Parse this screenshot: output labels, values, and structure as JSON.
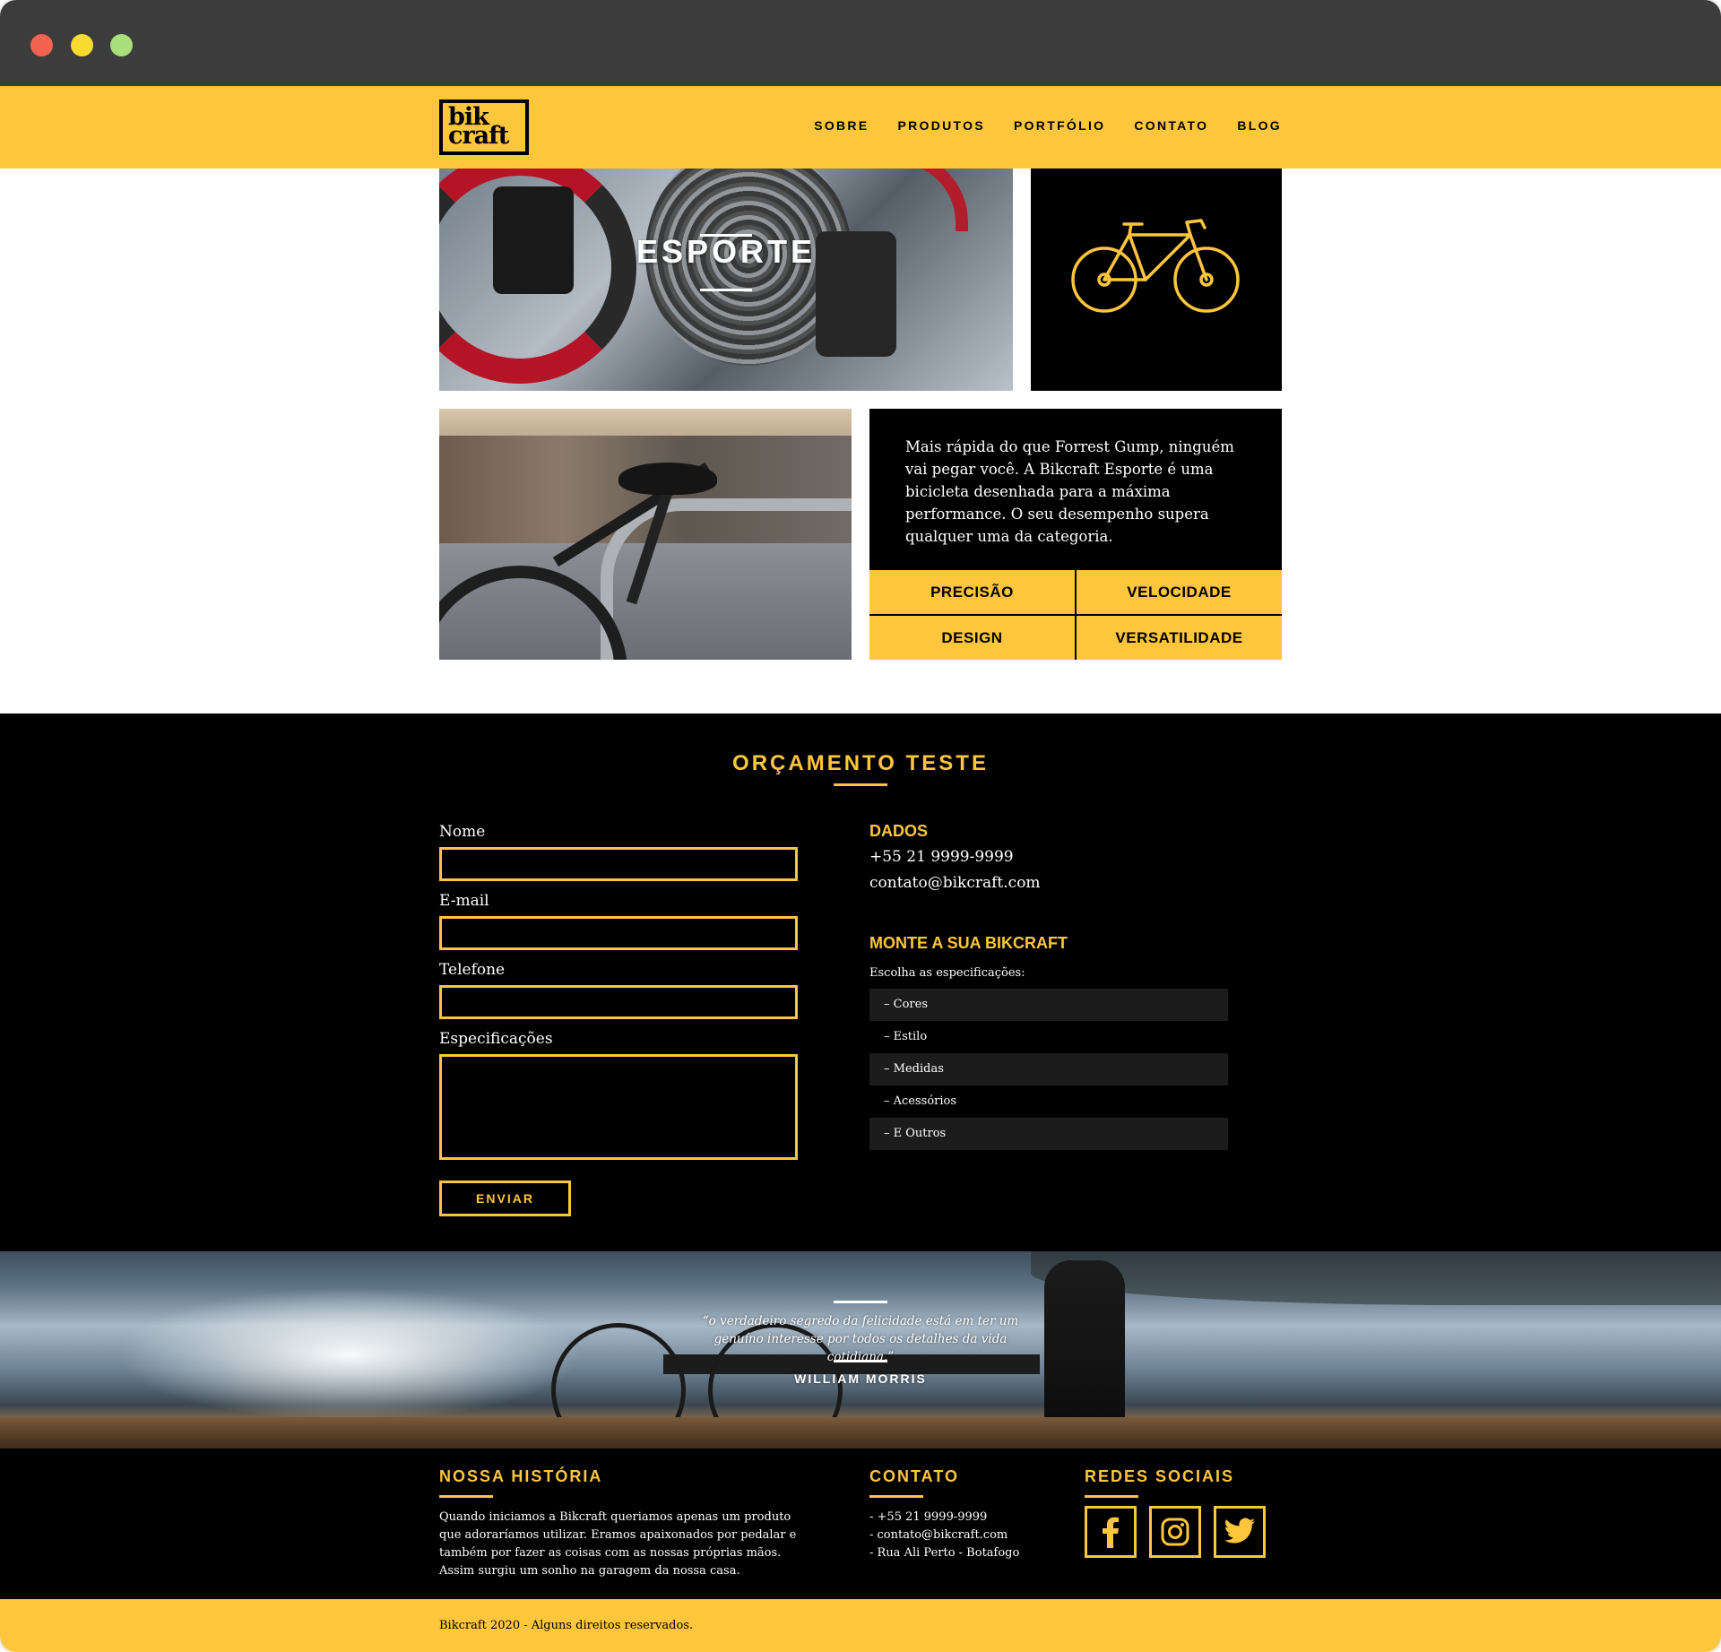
{
  "header": {
    "logo_line1": "bik",
    "logo_line2": "craft",
    "nav": [
      "SOBRE",
      "PRODUTOS",
      "PORTFÓLIO",
      "CONTATO",
      "BLOG"
    ]
  },
  "hero": {
    "title": "ESPORTE"
  },
  "product": {
    "description": "Mais rápida do que Forrest Gump, ninguém vai pegar você. A Bikcraft Esporte é uma bicicleta desenhada para a máxima performance. O seu desempenho supera qualquer uma da categoria.",
    "features": [
      "PRECISÃO",
      "VELOCIDADE",
      "DESIGN",
      "VERSATILIDADE"
    ]
  },
  "form": {
    "title": "ORÇAMENTO TESTE",
    "name_label": "Nome",
    "email_label": "E-mail",
    "phone_label": "Telefone",
    "specs_label": "Especificações",
    "submit_label": "ENVIAR"
  },
  "info": {
    "dados_title": "DADOS",
    "phone": "+55 21 9999-9999",
    "email": "contato@bikcraft.com",
    "build_title": "MONTE A SUA BIKCRAFT",
    "build_intro": "Escolha as especificações:",
    "specs": [
      "– Cores",
      "– Estilo",
      "– Medidas",
      "– Acessórios",
      "– E Outros"
    ]
  },
  "quote": {
    "text": "“o verdadeiro segredo da felicidade está em ter um genuíno interesse por todos os detalhes da vida cotidiana.”",
    "author": "WILLIAM MORRIS"
  },
  "footer": {
    "history_title": "NOSSA HISTÓRIA",
    "history_text": "Quando iniciamos a Bikcraft queriamos apenas um produto que adoraríamos utilizar. Eramos apaixonados por pedalar e também por fazer as coisas com as nossas próprias mãos. Assim surgiu um sonho na garagem da nossa casa.",
    "contact_title": "CONTATO",
    "contact_lines": [
      "- +55 21 9999-9999",
      "- contato@bikcraft.com",
      "- Rua Ali Perto - Botafogo"
    ],
    "social_title": "REDES SOCIAIS",
    "social_icons": [
      "facebook-icon",
      "instagram-icon",
      "twitter-icon"
    ],
    "copyright": "Bikcraft 2020 - Alguns direitos reservados."
  },
  "colors": {
    "accent": "#fec63d",
    "dark": "#000000",
    "chrome": "#3c3c3c"
  }
}
